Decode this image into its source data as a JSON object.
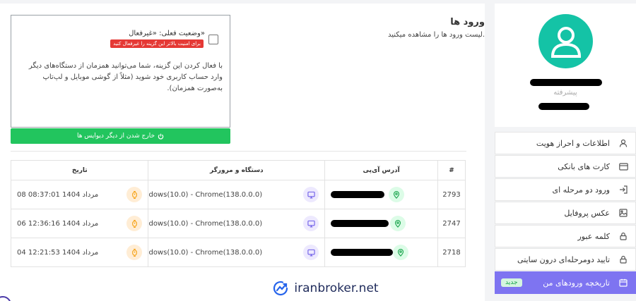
{
  "profile": {
    "level": "پیشرفته"
  },
  "sidebar": {
    "items": [
      {
        "label": "اطلاعات و احراز هویت",
        "icon": "user-icon"
      },
      {
        "label": "کارت های بانکی",
        "icon": "credit-card-icon"
      },
      {
        "label": "ورود دو مرحله ای",
        "icon": "login-icon"
      },
      {
        "label": "عکس پروفایل",
        "icon": "image-icon"
      },
      {
        "label": "کلمه عبور",
        "icon": "lock-icon"
      },
      {
        "label": "تایید دومرحله‌ای درون سایتی",
        "icon": "lock-icon"
      },
      {
        "label": "تاریخچه ورودهای من",
        "icon": "calendar-icon",
        "badge": "جدید",
        "active": true
      }
    ]
  },
  "header": {
    "title": "ورود ها",
    "description": "لیست ورود ها را مشاهده میکنید."
  },
  "option": {
    "status": "وضعیت فعلی: «غیرفعال»",
    "warning": "برای امنیت بالاتر این گزینه را غیرفعال کنید",
    "description": "با فعال کردن این گزینه، شما می‌توانید همزمان از دستگاه‌های دیگر وارد حساب کاربری خود شوید (مثلاً از گوشی موبایل و لپ‌تاپ به‌صورت همزمان).",
    "logout_label": "خارج شدن از دیگر دیوایس ها"
  },
  "table": {
    "headers": {
      "id": "#",
      "ip": "آدرس آی‌پی",
      "device": "دستگاه و مرورگر",
      "date": "تاریخ"
    },
    "rows": [
      {
        "id": "2793",
        "device": "dows(10.0) - Chrome(138.0.0.0)",
        "date": "08 مرداد 1404 08:37:01"
      },
      {
        "id": "2747",
        "device": "dows(10.0) - Chrome(138.0.0.0)",
        "date": "06 مرداد 1404 12:36:16"
      },
      {
        "id": "2718",
        "device": "dows(10.0) - Chrome(138.0.0.0)",
        "date": "04 مرداد 1404 12:21:53"
      }
    ]
  },
  "watermark": {
    "text": "iranbroker.net"
  },
  "colors": {
    "accent": "#7e74f1",
    "success": "#22c55e",
    "danger": "#e53935",
    "avatar": "#14c3a6"
  }
}
